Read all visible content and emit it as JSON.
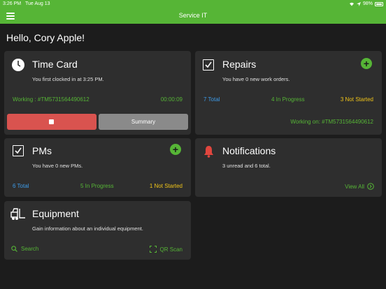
{
  "status_bar": {
    "time": "3:26 PM",
    "date": "Tue Aug 13",
    "battery": "98%"
  },
  "nav": {
    "title": "Service IT"
  },
  "greeting": "Hello, Cory Apple!",
  "time_card": {
    "title": "Time Card",
    "subtitle": "You first clocked in at 3:25 PM.",
    "working": "Working : #TM5731564490612",
    "timer": "00:00:09",
    "summary_label": "Summary"
  },
  "repairs": {
    "title": "Repairs",
    "subtitle": "You have 0 new work orders.",
    "total": "7 Total",
    "in_progress": "4 In Progress",
    "not_started": "3 Not Started",
    "working_on": "Working on: #TM5731564490612"
  },
  "pms": {
    "title": "PMs",
    "subtitle": "You have 0 new PMs.",
    "total": "6 Total",
    "in_progress": "5 In Progress",
    "not_started": "1 Not Started"
  },
  "notifications": {
    "title": "Notifications",
    "subtitle": "3 unread and 6 total.",
    "view_all": "View All"
  },
  "equipment": {
    "title": "Equipment",
    "subtitle": "Gain information about an individual equipment.",
    "search_label": "Search",
    "qr_label": "QR Scan"
  },
  "colors": {
    "accent": "#56b536",
    "danger": "#d9534f",
    "warning": "#f0c419",
    "info": "#3d9be9"
  }
}
